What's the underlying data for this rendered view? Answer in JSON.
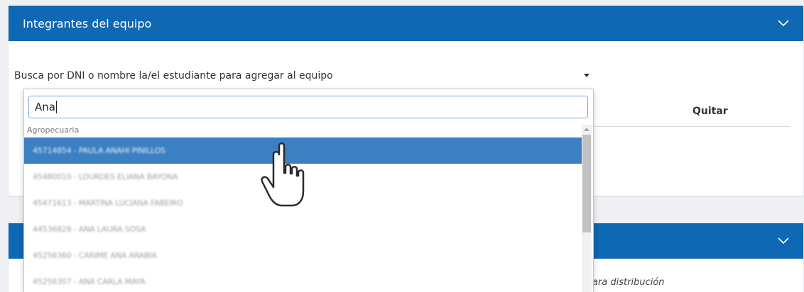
{
  "team_card": {
    "title": "Integrantes del equipo",
    "search_placeholder": "Busca por DNI o nombre la/el estudiante para agregar al equipo",
    "col_quitar": "Quitar"
  },
  "dropdown": {
    "query": "Ana",
    "group": "Agropecuaria",
    "options": [
      "45714854 - PAULA ANAHI PINILLOS",
      "45480010 - LOURDES ELIANA BAYONA",
      "45471613 - MARTINA LUCIANA FABEIRO",
      "44536828 - ANA LAURA SOSA",
      "45256360 - CARIME ANA ARABIA",
      "45256307 - ANA CARLA MAYA"
    ],
    "active_index": 0
  },
  "second_card": {
    "footer_text": "ara distribución"
  },
  "colors": {
    "header_blue": "#0e68b3",
    "option_highlight": "#3a80c2"
  },
  "icons": {
    "collapse": "chevron-down-icon",
    "cursor": "hand-pointer-icon"
  }
}
